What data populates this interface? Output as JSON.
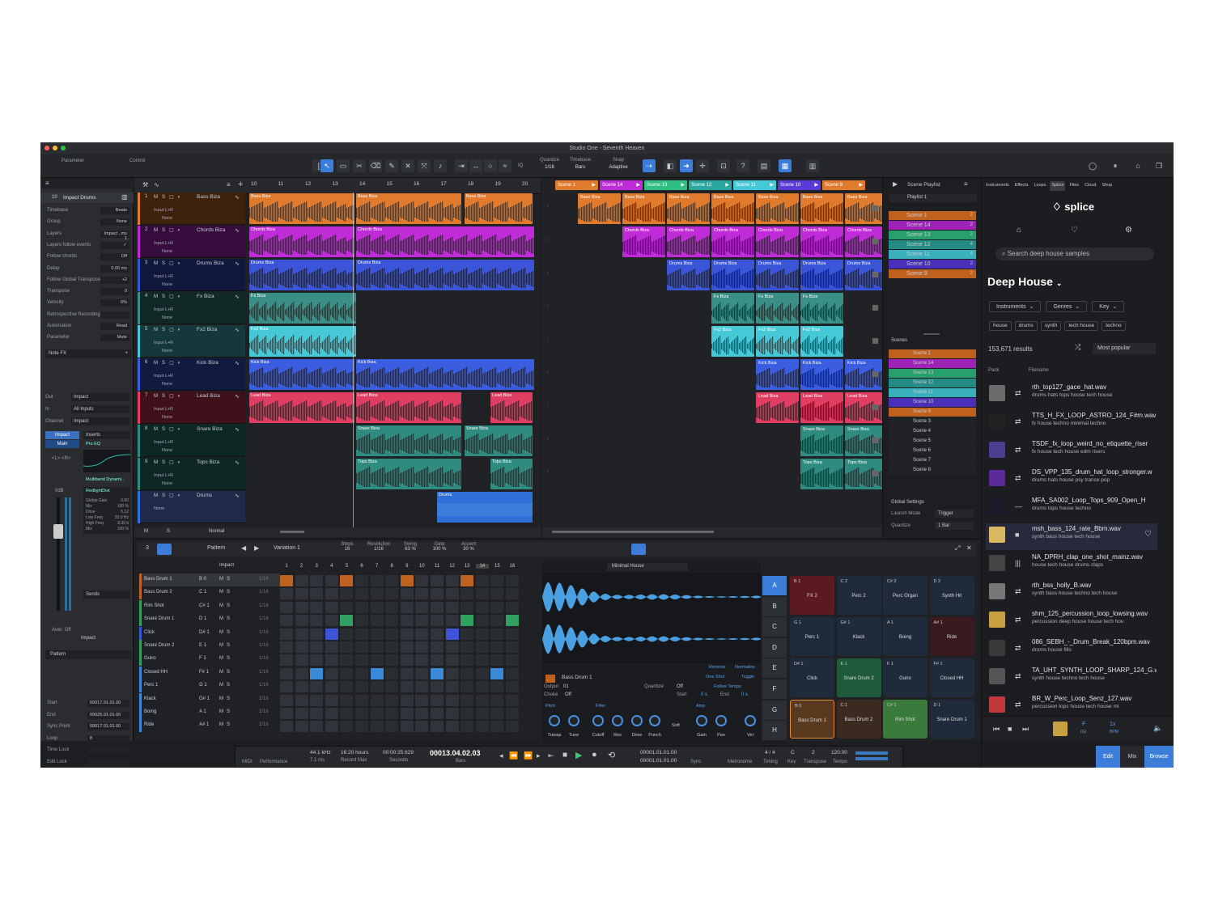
{
  "app": {
    "title": "Studio One - Seventh Heaven"
  },
  "toolbar": {
    "parameter": "Parameter",
    "control": "Control",
    "quantize_label": "Quantize",
    "quantize_value": "1/16",
    "timebase_label": "Timebase",
    "timebase_value": "Bars",
    "snap_label": "Snap",
    "snap_value": "Adaptive",
    "iq": "IQ"
  },
  "inspector": {
    "track_num": "10",
    "track_name": "Impact Drums",
    "rows": [
      {
        "label": "Timebase",
        "value": "Beats"
      },
      {
        "label": "Group",
        "value": "None"
      },
      {
        "label": "Layers",
        "value": "Impact ..ms 1"
      },
      {
        "label": "Layers follow events",
        "value": "✓"
      },
      {
        "label": "Follow chords",
        "value": "Off"
      },
      {
        "label": "Delay",
        "value": "0.00 ms"
      },
      {
        "label": "Follow Global Transpose",
        "value": "+2"
      },
      {
        "label": "Transpose",
        "value": "0"
      },
      {
        "label": "Velocity",
        "value": "0%"
      },
      {
        "label": "Retrospective Recording",
        "value": ""
      },
      {
        "label": "Automation",
        "value": "Read"
      },
      {
        "label": "Parameter",
        "value": "Mute"
      }
    ],
    "note_fx": "Note FX",
    "out_label": "Out",
    "out_value": "Impact",
    "in_label": "In",
    "in_value": "All Inputs",
    "channel_label": "Channel",
    "channel_value": "Impact",
    "impact_tab": "Impact",
    "main_tab": "Main",
    "inserts": "Inserts",
    "pro_eq": "Pro EQ",
    "multiband": "Multiband Dynami..",
    "redlight": "RedlightDist",
    "fx_params": [
      {
        "label": "Global Gain",
        "value": "0.00"
      },
      {
        "label": "Mix",
        "value": "100 %"
      },
      {
        "label": "Drive",
        "value": "5.12"
      },
      {
        "label": "Low Freq",
        "value": "20.0 Hz"
      },
      {
        "label": "High Freq",
        "value": "8.30 k"
      },
      {
        "label": "Mix",
        "value": "100 %"
      }
    ],
    "sends": "Sends",
    "db": "0dB",
    "auto_off": "Auto: Off",
    "ch_name": "Impact",
    "lr": "<L> <R>"
  },
  "pattern_inspector": {
    "title": "Pattern",
    "rows": [
      {
        "label": "Start",
        "value": "00017.01.01.00"
      },
      {
        "label": "End",
        "value": "00025.01.01.00"
      },
      {
        "label": "Sync Point",
        "value": "00017.01.01.00"
      },
      {
        "label": "Loop",
        "value": "8"
      },
      {
        "label": "Time Lock",
        "value": ""
      },
      {
        "label": "Edit Lock",
        "value": ""
      }
    ]
  },
  "ruler": [
    "10",
    "11",
    "12",
    "13",
    "14",
    "15",
    "16",
    "17",
    "18",
    "19",
    "20"
  ],
  "tracks": [
    {
      "num": "1",
      "name": "Bass Biza",
      "color": "#e07a2c",
      "input": "Input L+R",
      "none": "None",
      "clips": [
        "Bass Biza",
        "Bass Biza",
        "Bass Biza"
      ]
    },
    {
      "num": "2",
      "name": "Chords Biza",
      "color": "#c02bd8",
      "input": "Input L+R",
      "none": "None",
      "clips": [
        "Chords Biza",
        "Chords Biza"
      ]
    },
    {
      "num": "3",
      "name": "Drums Biza",
      "color": "#3a55d8",
      "input": "Input L+R",
      "none": "None",
      "clips": [
        "Drums Biza",
        "Drums Biza"
      ]
    },
    {
      "num": "4",
      "name": "Fx Biza",
      "color": "#3a8f86",
      "input": "Input L+R",
      "none": "None",
      "clips": [
        "Fx Biza"
      ]
    },
    {
      "num": "5",
      "name": "Fx2 Biza",
      "color": "#46c9d6",
      "input": "Input L+R",
      "none": "None",
      "clips": [
        "Fx2 Biza"
      ]
    },
    {
      "num": "6",
      "name": "Kick Biza",
      "color": "#3b5ee0",
      "input": "Input L+R",
      "none": "None",
      "clips": [
        "Kick Biza",
        "Kick Biza"
      ]
    },
    {
      "num": "7",
      "name": "Lead Biza",
      "color": "#e03d62",
      "input": "Input L+R",
      "none": "None",
      "clips": [
        "Lead Biza",
        "Lead Biza",
        "Lead Biza"
      ]
    },
    {
      "num": "8",
      "name": "Snare Biza",
      "color": "#2f8a80",
      "input": "Input L+R",
      "none": "None",
      "clips": [
        "Snare Biza",
        "Snare Biza"
      ]
    },
    {
      "num": "9",
      "name": "Tops Biza",
      "color": "#2f8a80",
      "input": "Input L+R",
      "none": "None",
      "clips": [
        "Tops Biza",
        "Tops Biza"
      ]
    },
    {
      "num": "",
      "name": "Drums",
      "color": "#2f6fd8",
      "input": "None",
      "none": "",
      "clips": [
        "Drums"
      ]
    }
  ],
  "arrange_footer": {
    "mode": "Normal"
  },
  "scenes_header": [
    "Scene 1",
    "Scene 14",
    "Scene 13",
    "Scene 12",
    "Scene 11",
    "Scene 10",
    "Scene 9"
  ],
  "scene_colors": [
    "#e07a2c",
    "#c02bd8",
    "#2fbf83",
    "#2aa8a0",
    "#46c9d6",
    "#5a3ad8",
    "#e07a2c"
  ],
  "launcher": {
    "row_labels": [
      [
        "Bass Biza",
        "Bass Biza",
        "Bass Biza",
        "Bass Biza",
        "Bass Biza",
        "Bass Biza",
        "Bass Biza"
      ],
      [
        "Chords Biza",
        "Chords Biza",
        "Chords Biza",
        "Chords Biza",
        "Chords Biza",
        "Chords Biza"
      ],
      [
        "Drums Biza",
        "Drums Biza",
        "Drums Biza",
        "Drums Biza",
        "Drums Biza"
      ],
      [
        "Fx Biza",
        "Fx Biza",
        "Fx Biza"
      ],
      [
        "Fx2 Biza",
        "Fx2 Biza",
        "Fx2 Biza"
      ],
      [
        "Kick Biza",
        "Kick Biza",
        "Kick Biza"
      ],
      [
        "Lead Biza",
        "Lead Biza",
        "Lead Biza"
      ],
      [
        "Snare Biza",
        "Snare Biza"
      ],
      [
        "Tops Biza",
        "Tops Biza"
      ]
    ]
  },
  "playlist": {
    "title": "Scene Playlist",
    "name": "Playlist 1",
    "items": [
      {
        "name": "Scene 1",
        "n": "2",
        "color": "#c0621f"
      },
      {
        "name": "Scene 14",
        "n": "2",
        "color": "#a023b8"
      },
      {
        "name": "Scene 13",
        "n": "2",
        "color": "#28a06d"
      },
      {
        "name": "Scene 12",
        "n": "4",
        "color": "#238c85"
      },
      {
        "name": "Scene 11",
        "n": "4",
        "color": "#3ab0bc"
      },
      {
        "name": "Scene 10",
        "n": "2",
        "color": "#4a30b8"
      },
      {
        "name": "Scene 9",
        "n": "2",
        "color": "#c0621f"
      }
    ],
    "scenes_title": "Scenes",
    "scenes": [
      {
        "name": "Scene 1",
        "color": "#c0621f"
      },
      {
        "name": "Scene 14",
        "color": "#a023b8"
      },
      {
        "name": "Scene 13",
        "color": "#28a06d"
      },
      {
        "name": "Scene 12",
        "color": "#238c85"
      },
      {
        "name": "Scene 11",
        "color": "#3ab0bc"
      },
      {
        "name": "Scene 10",
        "color": "#4a30b8"
      },
      {
        "name": "Scene 9",
        "color": "#c0621f"
      },
      {
        "name": "Scene 3",
        "color": ""
      },
      {
        "name": "Scene 4",
        "color": ""
      },
      {
        "name": "Scene 5",
        "color": ""
      },
      {
        "name": "Scene 6",
        "color": ""
      },
      {
        "name": "Scene 7",
        "color": ""
      },
      {
        "name": "Scene 8",
        "color": ""
      }
    ],
    "global_settings": "Global Settings",
    "launch_mode_label": "Launch Mode",
    "launch_mode": "Trigger",
    "quantize_label": "Quantize",
    "quantize": "1 Bar"
  },
  "browser_tabs": [
    "Instruments",
    "Effects",
    "Loops",
    "Splice",
    "Files",
    "Cloud",
    "Shop"
  ],
  "splice": {
    "logo": "splice",
    "search_placeholder": "Search deep house samples",
    "title": "Deep House",
    "filters": [
      "Instruments",
      "Genres",
      "Key"
    ],
    "tags": [
      "house",
      "drums",
      "synth",
      "tech house",
      "techno"
    ],
    "results": "153,671 results",
    "sort": "Most popular",
    "col_pack": "Pack",
    "col_filename": "Filename",
    "samples": [
      {
        "file": "rth_top127_gace_hat.wav",
        "tags": "drums   hats   tops   house   tech house",
        "color": "#6b6b6b"
      },
      {
        "file": "TTS_H_FX_LOOP_ASTRO_124_F#m.wav",
        "tags": "fx   house   techno   minimal techno",
        "color": "#222"
      },
      {
        "file": "TSDF_fx_loop_weird_no_etiquette_riser",
        "tags": "fx   house   tech house   edm   risers",
        "color": "#4a3f8f"
      },
      {
        "file": "DS_VPP_135_drum_hat_loop_stronger.w",
        "tags": "drums   hats   house   psy trance   pop",
        "color": "#5a2a9a"
      },
      {
        "file": "MFA_SA002_Loop_Tops_909_Open_H",
        "tags": "drums   tops   house   techno",
        "color": "#1a1a2a"
      },
      {
        "file": "msh_bass_124_rate_Bbm.wav",
        "tags": "synth   bass   house   tech house",
        "color": "#d8b860"
      },
      {
        "file": "NA_DPRH_clap_one_shot_mainz.wav",
        "tags": "house   tech house   drums   claps",
        "color": "#444"
      },
      {
        "file": "rth_bss_holly_B.wav",
        "tags": "synth   bass   house   techno   tech house",
        "color": "#777"
      },
      {
        "file": "shm_125_percussion_loop_lowsing.wav",
        "tags": "percussion   deep house   house   tech hou",
        "color": "#c8a040"
      },
      {
        "file": "086_SEBH_-_Drum_Break_120bpm.wav",
        "tags": "drums   house   fills",
        "color": "#3a3a3a"
      },
      {
        "file": "TA_UHT_SYNTH_LOOP_SHARP_124_G.w",
        "tags": "synth   house   techno   tech house",
        "color": "#555"
      },
      {
        "file": "BR_W_Perc_Loop_Senz_127.wav",
        "tags": "percussion   tops   house   tech house   mi",
        "color": "#c03a3a"
      }
    ],
    "player_key": "F",
    "player_key_sub": "(G)",
    "player_bpm": "1x",
    "player_bpm_sub": "BPM"
  },
  "pattern_editor": {
    "pattern": "Pattern",
    "variation": "Variation 1",
    "steps_label": "Steps",
    "steps": "16",
    "res_label": "Resolution",
    "res": "1/16",
    "swing_label": "Swing",
    "swing": "63 %",
    "gate_label": "Gate",
    "gate": "100 %",
    "accent_label": "Accent",
    "accent": "30 %",
    "instrument": "Impact",
    "col_num": "3",
    "step_numbers": [
      "1",
      "2",
      "3",
      "4",
      "5",
      "6",
      "7",
      "8",
      "9",
      "10",
      "11",
      "12",
      "13",
      "14",
      "15",
      "16"
    ],
    "rows": [
      {
        "name": "Bass Drum 1",
        "key": "B 0",
        "res": "1/16",
        "color": "#c0621f"
      },
      {
        "name": "Bass Drum 2",
        "key": "C 1",
        "res": "1/16",
        "color": "#c0621f"
      },
      {
        "name": "Rim Shot",
        "key": "C# 1",
        "res": "1/16",
        "color": "#2fa060"
      },
      {
        "name": "Snare Drum 1",
        "key": "D 1",
        "res": "1/16",
        "color": "#2fa060"
      },
      {
        "name": "Click",
        "key": "D# 1",
        "res": "1/16",
        "color": "#3a55d8"
      },
      {
        "name": "Snare Drum 2",
        "key": "E 1",
        "res": "1/16",
        "color": "#2fa060"
      },
      {
        "name": "Guiro",
        "key": "F 1",
        "res": "1/16",
        "color": "#2fa060"
      },
      {
        "name": "Closed HH",
        "key": "F# 1",
        "res": "1/16",
        "color": "#3a8ad8"
      },
      {
        "name": "Perc 1",
        "key": "G 1",
        "res": "1/16",
        "color": "#3a8ad8"
      },
      {
        "name": "Klack",
        "key": "G# 1",
        "res": "1/16",
        "color": "#3a8ad8"
      },
      {
        "name": "Boing",
        "key": "A 1",
        "res": "1/16",
        "color": "#3a8ad8"
      },
      {
        "name": "Ride",
        "key": "A# 1",
        "res": "1/16",
        "color": "#3a8ad8"
      }
    ]
  },
  "impact": {
    "preset": "Minimal House",
    "pad_name": "Bass Drum 1",
    "reverse": "Reverse",
    "normalize": "Normalize",
    "one_shot": "One Shot",
    "toggle": "Toggle",
    "output_label": "Output",
    "output": "01",
    "choke_label": "Choke",
    "choke": "Off",
    "quantize_label": "Quantize",
    "quantize": "Off",
    "follow_tempo": "Follow Tempo",
    "start_label": "Start",
    "start": "0 s",
    "end_label": "End",
    "end": "0 s",
    "pitch": "Pitch",
    "filter": "Filter",
    "amp": "Amp",
    "soft": "Soft",
    "knobs": [
      "Transp",
      "Tune",
      "Cutoff",
      "Res",
      "Drive",
      "Punch",
      "Gain",
      "Pan",
      "Vel"
    ],
    "banks": [
      "A",
      "B",
      "C",
      "D",
      "E",
      "F",
      "G",
      "H"
    ],
    "pads": [
      {
        "key": "B 1",
        "name": "FX 2",
        "color": "#5a1a1f"
      },
      {
        "key": "C 2",
        "name": "Perc 2",
        "color": "#1f2a3a"
      },
      {
        "key": "C# 2",
        "name": "Perc Organ",
        "color": "#1f2a3a"
      },
      {
        "key": "D 2",
        "name": "Synth Hit",
        "color": "#1f2a3a"
      },
      {
        "key": "G 1",
        "name": "Perc 1",
        "color": "#1f2a3a"
      },
      {
        "key": "G# 1",
        "name": "Klack",
        "color": "#1f2a3a"
      },
      {
        "key": "A 1",
        "name": "Boing",
        "color": "#1f2a3a"
      },
      {
        "key": "A# 1",
        "name": "Ride",
        "color": "#3a1a1f"
      },
      {
        "key": "D# 1",
        "name": "Click",
        "color": "#1f2a3a"
      },
      {
        "key": "E 1",
        "name": "Snare Drum 2",
        "color": "#1f5a3a"
      },
      {
        "key": "F 1",
        "name": "Guiro",
        "color": "#1f2a3a"
      },
      {
        "key": "F# 1",
        "name": "Closed HH",
        "color": "#1f2a3a"
      },
      {
        "key": "B 0",
        "name": "Bass Drum 1",
        "color": "#5a3a1f"
      },
      {
        "key": "C 1",
        "name": "Bass Drum 2",
        "color": "#3a2a1f"
      },
      {
        "key": "C# 1",
        "name": "Rim Shot",
        "color": "#3a7a3a"
      },
      {
        "key": "D 1",
        "name": "Snare Drum 1",
        "color": "#1f2a3a"
      }
    ]
  },
  "transport": {
    "midi": "MIDI",
    "performance": "Performance",
    "sample_rate": "44.1 kHz",
    "latency": "7.1 ms",
    "record_hours": "16:20 hours",
    "record_max": "Record Max",
    "seconds_value": "00:00:25.629",
    "seconds_label": "Seconds",
    "bars_value": "00013.04.02.03",
    "bars_label": "Bars",
    "loop_start": "00001.01.01.00",
    "loop_end": "00001.01.01.00",
    "sync": "Sync",
    "metronome": "Metronome",
    "timing_value": "4 / 4",
    "timing_label": "Timing",
    "key_value": "C",
    "key_label": "Key",
    "transpose_value": "2",
    "transpose_label": "Transpose",
    "tempo_value": "120.00",
    "tempo_label": "Tempo"
  },
  "view_tabs": {
    "edit": "Edit",
    "mix": "Mix",
    "browse": "Browse"
  }
}
